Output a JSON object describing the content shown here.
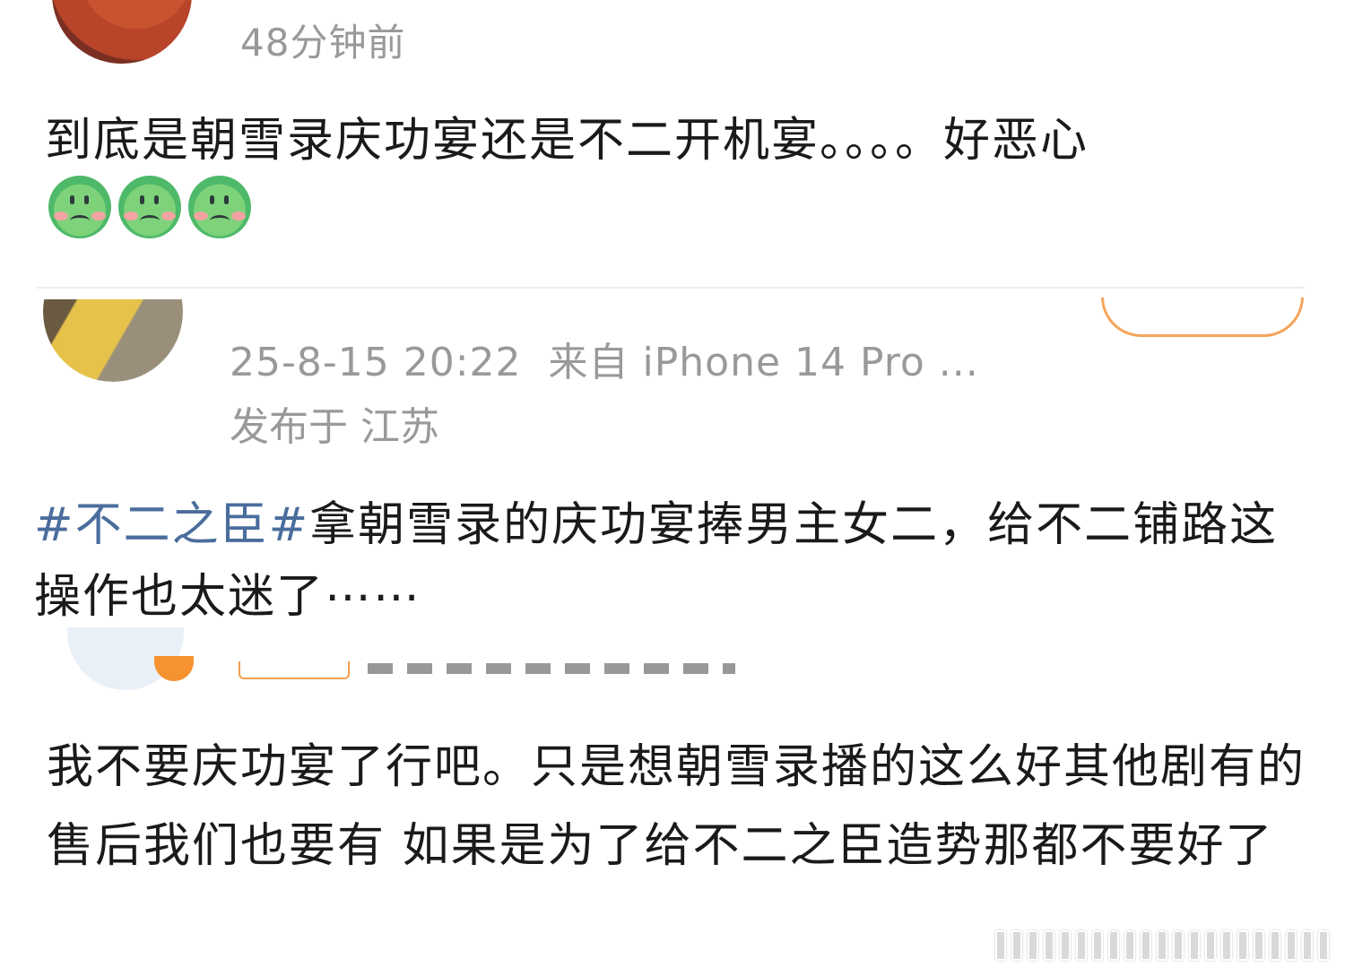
{
  "post1": {
    "time": "48分钟前",
    "text": "到底是朝雪录庆功宴还是不二开机宴。。。。好恶心",
    "emojis": [
      "nauseated-face-icon",
      "nauseated-face-icon",
      "nauseated-face-icon"
    ]
  },
  "post2": {
    "datetime": "25-8-15 20:22",
    "source": "来自 iPhone 14 Pro ...",
    "location": "发布于 江苏",
    "hashtag": "#不二之臣#",
    "text": "拿朝雪录的庆功宴捧男主女二，给不二铺路这操作也太迷了⋯⋯"
  },
  "post3": {
    "text": "我不要庆功宴了行吧。只是想朝雪录播的这么好其他剧有的售后我们也要有 如果是为了给不二之臣造势那都不要好了"
  },
  "colors": {
    "hashtag": "#4a6d9c",
    "meta_gray": "#999999",
    "follow_orange": "#f4a45b"
  }
}
